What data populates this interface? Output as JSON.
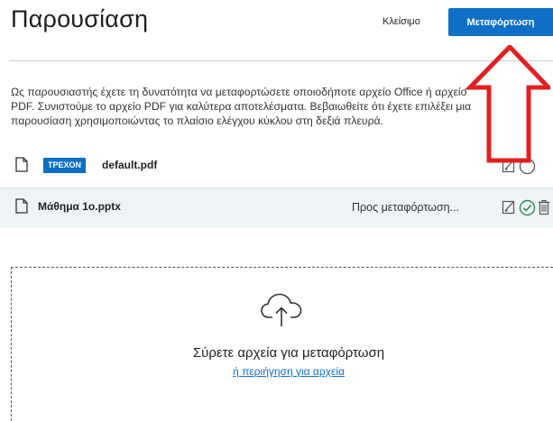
{
  "header": {
    "title": "Παρουσίαση",
    "close_label": "Κλείσιμο",
    "upload_label": "Μεταφόρτωση"
  },
  "description": {
    "lines": [
      "Ως παρουσιαστής έχετε τη δυνατότητα να μεταφορτώσετε οποιοδήποτε αρχείο Office ή αρχείο",
      "PDF. Συνιστούμε το αρχείο PDF για καλύτερα αποτελέσματα. Βεβαιωθείτε ότι έχετε επιλέξει μια",
      "παρουσίαση χρησιμοποιώντας το πλαίσιο ελέγχου κύκλου στη δεξιά πλευρά."
    ]
  },
  "files": [
    {
      "badge": "ΤΡΕΧΟΝ",
      "name": "default.pdf",
      "status": "",
      "selected": false
    },
    {
      "badge": "",
      "name": "Μάθημα 1ο.pptx",
      "status": "Προς μεταφόρτωση...",
      "selected": true
    }
  ],
  "dropzone": {
    "text": "Σύρετε αρχεία για μεταφόρτωση",
    "link": "ή περιήγηση για αρχεία"
  },
  "colors": {
    "accent": "#0f6fc6",
    "annotation_arrow": "#e02020",
    "selected_row_bg": "#eef3f5",
    "check_green": "#2e8b57"
  }
}
